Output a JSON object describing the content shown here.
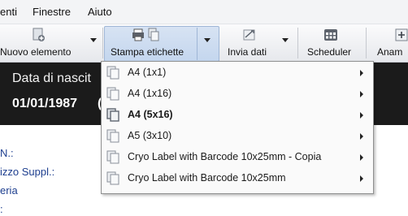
{
  "menubar": {
    "items": [
      "enti",
      "Finestre",
      "Aiuto"
    ]
  },
  "toolbar": {
    "new_element": "Nuovo elemento",
    "print_labels": "Stampa etichette",
    "send_data": "Invia dati",
    "scheduler": "Scheduler",
    "anam": "Anam"
  },
  "banner": {
    "label": "Data di nascit",
    "value": "01/01/1987",
    "value_cut": "("
  },
  "form": {
    "labels": [
      "N.:",
      "izzo Suppl.:",
      "eria",
      ":"
    ]
  },
  "dropdown": {
    "items": [
      {
        "label": "A4 (1x1)",
        "bold": false
      },
      {
        "label": "A4 (1x16)",
        "bold": false
      },
      {
        "label": "A4 (5x16)",
        "bold": true
      },
      {
        "label": "A5 (3x10)",
        "bold": false
      },
      {
        "label": "Cryo Label with Barcode 10x25mm - Copia",
        "bold": false
      },
      {
        "label": "Cryo Label with Barcode 10x25mm",
        "bold": false
      }
    ]
  }
}
